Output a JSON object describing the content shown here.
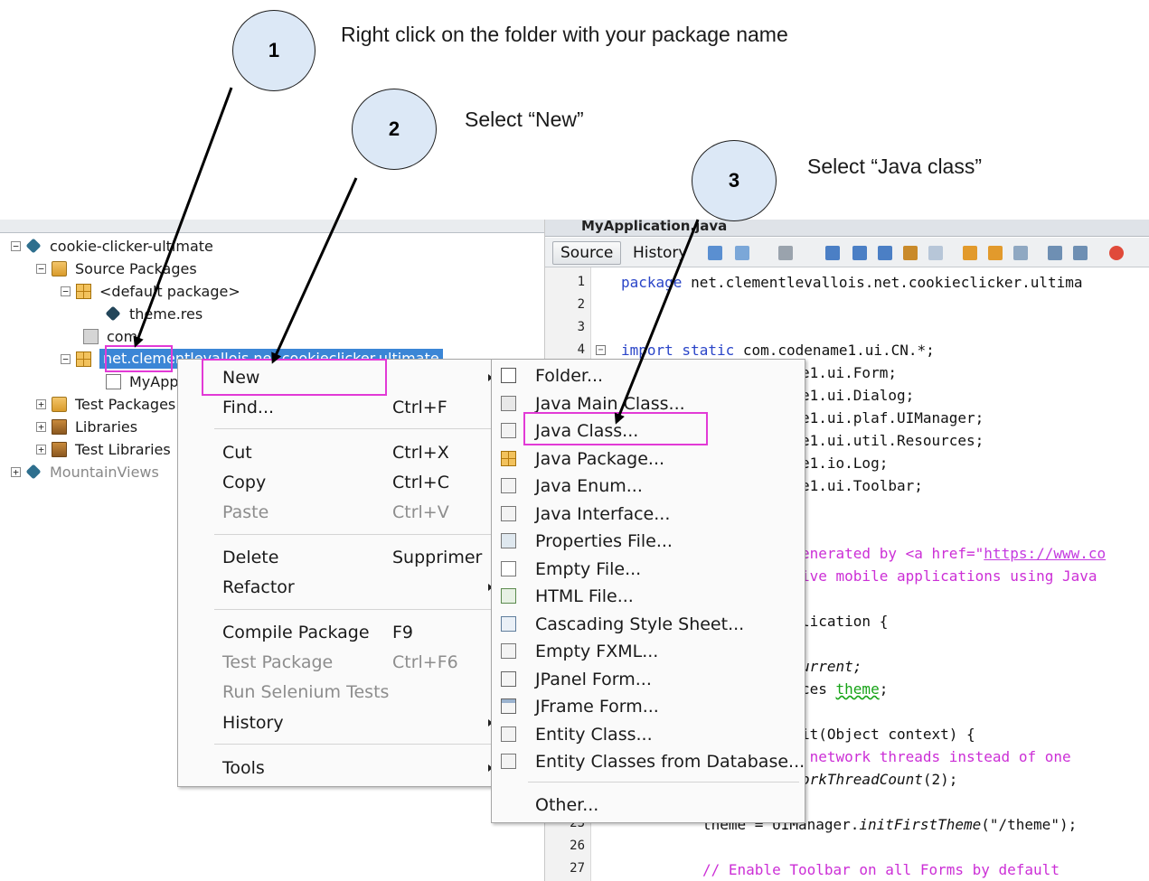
{
  "annotations": {
    "steps": [
      {
        "number": "1",
        "text": "Right click on the folder with your package name"
      },
      {
        "number": "2",
        "text": "Select “New”"
      },
      {
        "number": "3",
        "text": "Select “Java class”"
      }
    ]
  },
  "project_tree": {
    "project_name": "cookie-clicker-ultimate",
    "source_packages": "Source Packages",
    "default_package": "<default package>",
    "theme_file": "theme.res",
    "com_package": "com",
    "selected_package": "net.clementlevallois.net.cookieclicker.ultimate",
    "myapp_file": "MyApp",
    "test_packages": "Test Packages",
    "libraries": "Libraries",
    "test_libraries": "Test Libraries",
    "other_project": "MountainViews"
  },
  "editor": {
    "tab_title": "MyApplication.java",
    "toolbar": {
      "source": "Source",
      "history": "History"
    },
    "line_numbers": [
      "1",
      "2",
      "3",
      "4",
      "23",
      "26",
      "27"
    ],
    "code": {
      "l1_kw": "package",
      "l1_rest": " net.clementlevallois.net.cookieclicker.ultima",
      "l4_kw": "import static",
      "l4_rest": " com.codename1.ui.CN.*;",
      "i5": "e1.ui.Form;",
      "i6": "e1.ui.Dialog;",
      "i7": "e1.ui.plaf.UIManager;",
      "i8": "e1.ui.util.Resources;",
      "i9": "e1.io.Log;",
      "i10": "e1.ui.Toolbar;",
      "c1a": "enerated by ",
      "c1b": "<a href=\"",
      "c1c": "https://www.co",
      "c2": "ive mobile applications using Java",
      "cls": "lication {",
      "f1": "urrent;",
      "f2a": "ces ",
      "f2b": "theme",
      "f2c": ";",
      "m1": "it(Object context) {",
      "m2": " network threads instead of one",
      "m3a": "orkThreadCount",
      "m3b": "(2);",
      "l23a": "theme = UIManager.",
      "l23b": "initFirstTheme",
      "l23c": "(\"/theme\");",
      "l27": "// Enable Toolbar on all Forms by default"
    }
  },
  "context_menu": {
    "items": [
      {
        "label": "New",
        "shortcut": "",
        "submenu": true
      },
      {
        "label": "Find...",
        "shortcut": "Ctrl+F"
      },
      {
        "label": "Cut",
        "shortcut": "Ctrl+X"
      },
      {
        "label": "Copy",
        "shortcut": "Ctrl+C"
      },
      {
        "label": "Paste",
        "shortcut": "Ctrl+V",
        "disabled": true
      },
      {
        "label": "Delete",
        "shortcut": "Supprimer"
      },
      {
        "label": "Refactor",
        "shortcut": "",
        "submenu": true
      },
      {
        "label": "Compile Package",
        "shortcut": "F9"
      },
      {
        "label": "Test Package",
        "shortcut": "Ctrl+F6",
        "disabled": true
      },
      {
        "label": "Run Selenium Tests",
        "shortcut": "",
        "disabled": true
      },
      {
        "label": "History",
        "shortcut": "",
        "submenu": true
      },
      {
        "label": "Tools",
        "shortcut": "",
        "submenu": true
      }
    ]
  },
  "new_submenu": {
    "items": [
      {
        "label": "Folder...",
        "icon": "folder-icon"
      },
      {
        "label": "Java Main Class...",
        "icon": "java-main-class-icon"
      },
      {
        "label": "Java Class...",
        "icon": "java-class-icon"
      },
      {
        "label": "Java Package...",
        "icon": "java-package-icon"
      },
      {
        "label": "Java Enum...",
        "icon": "java-enum-icon"
      },
      {
        "label": "Java Interface...",
        "icon": "java-interface-icon"
      },
      {
        "label": "Properties File...",
        "icon": "properties-file-icon"
      },
      {
        "label": "Empty File...",
        "icon": "empty-file-icon"
      },
      {
        "label": "HTML File...",
        "icon": "html-file-icon"
      },
      {
        "label": "Cascading Style Sheet...",
        "icon": "css-file-icon"
      },
      {
        "label": "Empty FXML...",
        "icon": "fxml-file-icon"
      },
      {
        "label": "JPanel Form...",
        "icon": "jpanel-form-icon"
      },
      {
        "label": "JFrame Form...",
        "icon": "jframe-form-icon"
      },
      {
        "label": "Entity Class...",
        "icon": "entity-class-icon"
      },
      {
        "label": "Entity Classes from Database...",
        "icon": "entity-db-icon"
      },
      {
        "label": "Other...",
        "icon": ""
      }
    ]
  },
  "colors": {
    "highlight": "#e23ad6",
    "selection": "#3b86d6",
    "keyword": "#2a45c8",
    "comment": "#cc2fd6"
  }
}
